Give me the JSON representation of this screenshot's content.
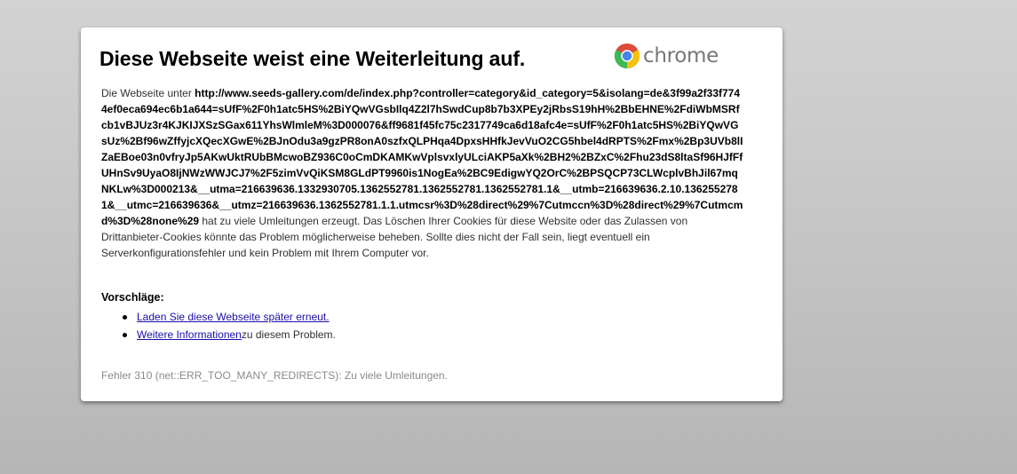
{
  "page": {
    "title": "Diese Webseite weist eine Weiterleitung auf.",
    "brand": {
      "name": "chrome",
      "icon": "chrome-icon",
      "colors": {
        "red": "#dd4b39",
        "yellow": "#f4c20d",
        "green": "#3cba54",
        "blue": "#4885ed"
      }
    },
    "details": {
      "prefix": "Die Webseite unter ",
      "url": "http://www.seeds-gallery.com/de/index.php?controller=category&id_category=5&isolang=de&3f99a2f33f7744ef0eca694ec6b1a644=sUfF%2F0h1atc5HS%2BiYQwVGsbIlq4Z2l7hSwdCup8b7b3XPEy2jRbsS19hH%2BbEHNE%2FdiWbMSRfcb1vBJUz3r4KJKIJXSzSGax611YhsWlmleM%3D000076&ff9681f45fc75c2317749ca6d18afc4e=sUfF%2F0h1atc5HS%2BiYQwVGsUz%2Bf96wZffyjcXQecXGwE%2BJnOdu3a9gzPR8onA0szfxQLPHqa4DpxsHHfkJevVuO2CG5hbel4dRPTS%2Fmx%2Bp3UVb8lIZaEBoe03n0vfryJp5AKwUktRUbBMcwoBZ936C0oCmDKAMKwVplsvxlyULciAKP5aXk%2BH2%2BZxC%2Fhu23dS8ltaSf96HJfFfUHnSv9UyaO8IjNWzWWJCJ7%2F5zimVvQiKSM8GLdPT9960is1NogEa%2BC9EdigwYQ2OrC%2BPSQCP73CLWcplvBhJil67mqNKLw%3D000213&__utma=216639636.1332930705.1362552781.1362552781.1362552781.1&__utmb=216639636.2.10.1362552781&__utmc=216639636&__utmz=216639636.1362552781.1.1.utmcsr%3D%28direct%29%7Cutmccn%3D%28direct%29%7Cutmcmd%3D%28none%29",
      "suffix": " hat zu viele Umleitungen erzeugt. Das Löschen Ihrer Cookies für diese Website oder das Zulassen von Drittanbieter-Cookies könnte das Problem möglicherweise beheben. Sollte dies nicht der Fall sein, liegt eventuell ein Serverkonfigurationsfehler und kein Problem mit Ihrem Computer vor."
    },
    "suggestions": {
      "heading": "Vorschläge:",
      "items": [
        {
          "link": "Laden Sie diese Webseite später erneut.",
          "after": ""
        },
        {
          "link": "Weitere Informationen",
          "after": " zu diesem Problem."
        }
      ]
    },
    "error_code": "Fehler 310 (net::ERR_TOO_MANY_REDIRECTS): Zu viele Umleitungen."
  }
}
